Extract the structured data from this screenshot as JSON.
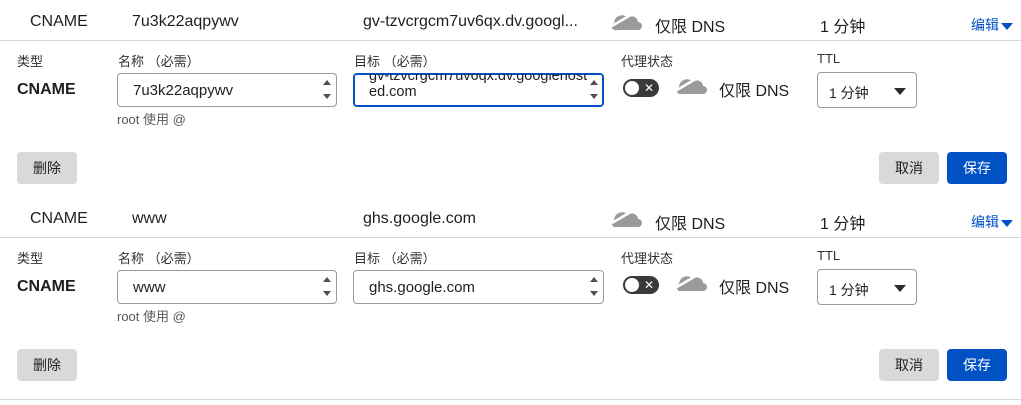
{
  "labels": {
    "type": "类型",
    "name": "名称 （必需）",
    "target": "目标 （必需）",
    "proxy_status": "代理状态",
    "ttl": "TTL",
    "root_hint": "root 使用 @",
    "edit": "编辑",
    "delete": "删除",
    "cancel": "取消",
    "save": "保存"
  },
  "records": [
    {
      "summary": {
        "type": "CNAME",
        "name": "7u3k22aqpywv",
        "content": "gv-tzvcrgcm7uv6qx.dv.googl...",
        "proxy": "仅限 DNS",
        "ttl": "1 分钟"
      },
      "form": {
        "type": "CNAME",
        "name_value": "7u3k22aqpywv",
        "target_value": "gv-tzvcrgcm7uv6qx.dv.googlehosted.com",
        "proxy_label": "仅限 DNS",
        "ttl_selected": "1 分钟"
      }
    },
    {
      "summary": {
        "type": "CNAME",
        "name": "www",
        "content": "ghs.google.com",
        "proxy": "仅限 DNS",
        "ttl": "1 分钟"
      },
      "form": {
        "type": "CNAME",
        "name_value": "www",
        "target_value": "ghs.google.com",
        "proxy_label": "仅限 DNS",
        "ttl_selected": "1 分钟"
      }
    }
  ],
  "icons": {
    "cloud": "cloud-dns-only-icon",
    "caret": "caret-down-icon",
    "toggle_off": "toggle-off-icon"
  },
  "colors": {
    "accent": "#0051c3",
    "cloud_grey": "#9a9a9a",
    "toggle_dark": "#3a3a3a",
    "button_grey": "#d9d9d9"
  }
}
